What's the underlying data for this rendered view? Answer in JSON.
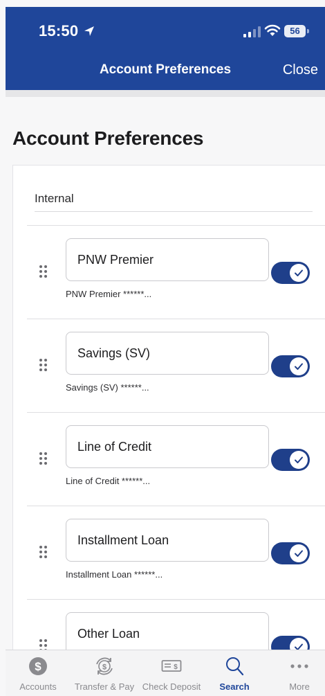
{
  "status_bar": {
    "time": "15:50",
    "battery": "56"
  },
  "nav": {
    "title": "Account Preferences",
    "close_label": "Close"
  },
  "page_title": "Account Preferences",
  "section": {
    "label": "Internal"
  },
  "accounts": [
    {
      "name": "PNW Premier",
      "subtitle": "PNW Premier ******...",
      "enabled": true
    },
    {
      "name": "Savings (SV)",
      "subtitle": "Savings (SV) ******...",
      "enabled": true
    },
    {
      "name": "Line of Credit",
      "subtitle": "Line of Credit ******...",
      "enabled": true
    },
    {
      "name": "Installment Loan",
      "subtitle": "Installment Loan ******...",
      "enabled": true
    },
    {
      "name": "Other Loan",
      "subtitle": "",
      "enabled": true
    }
  ],
  "tabbar": {
    "tabs": [
      {
        "label": "Accounts",
        "icon": "dollar-coin-icon"
      },
      {
        "label": "Transfer & Pay",
        "icon": "transfer-cycle-icon"
      },
      {
        "label": "Check Deposit",
        "icon": "check-icon"
      },
      {
        "label": "Search",
        "icon": "search-icon",
        "active": true
      },
      {
        "label": "More",
        "icon": "more-dots-icon"
      }
    ]
  },
  "colors": {
    "brand": "#1f469a",
    "toggle_on": "#1f3f8a",
    "tab_inactive": "#8a8a8e"
  }
}
